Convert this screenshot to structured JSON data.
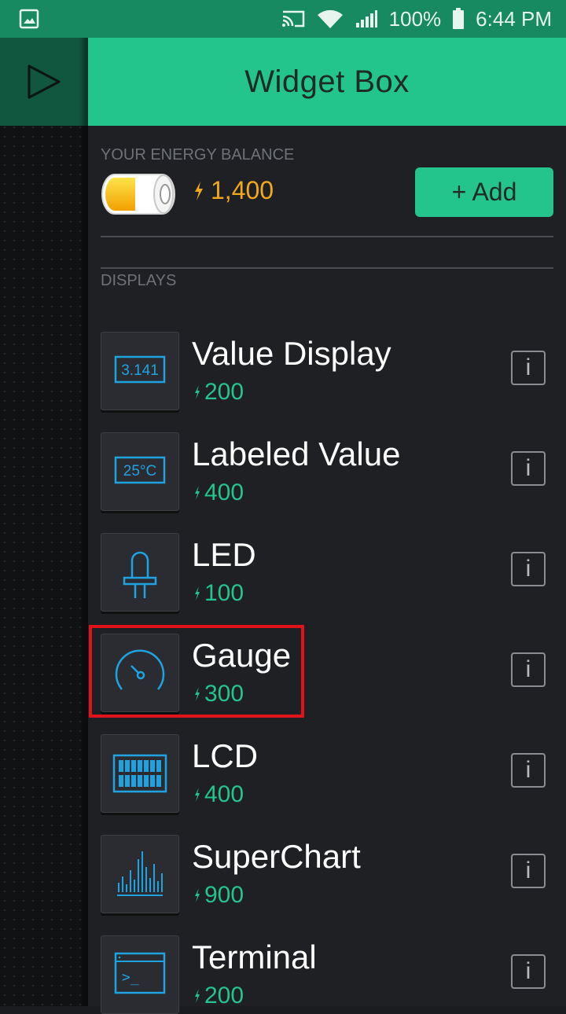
{
  "status_bar": {
    "battery_percent": "100%",
    "time": "6:44 PM"
  },
  "header": {
    "title": "Widget Box"
  },
  "energy": {
    "label": "YOUR ENERGY BALANCE",
    "balance": "1,400",
    "add_label": "+ Add"
  },
  "section": {
    "label": "DISPLAYS"
  },
  "widgets": [
    {
      "name": "Value Display",
      "cost": "200",
      "icon": "value-display-icon",
      "icon_text": "3.141"
    },
    {
      "name": "Labeled Value",
      "cost": "400",
      "icon": "labeled-value-icon",
      "icon_text": "25°C"
    },
    {
      "name": "LED",
      "cost": "100",
      "icon": "led-icon"
    },
    {
      "name": "Gauge",
      "cost": "300",
      "icon": "gauge-icon"
    },
    {
      "name": "LCD",
      "cost": "400",
      "icon": "lcd-icon"
    },
    {
      "name": "SuperChart",
      "cost": "900",
      "icon": "superchart-icon"
    },
    {
      "name": "Terminal",
      "cost": "200",
      "icon": "terminal-icon",
      "icon_text": ">_"
    }
  ],
  "info_label": "i",
  "colors": {
    "accent": "#24c48d",
    "status_bar": "#178a61",
    "energy": "#f2a81d",
    "icon_blue": "#1fa3e0",
    "highlight": "#e0131b",
    "drawer_bg": "#1f2024"
  }
}
